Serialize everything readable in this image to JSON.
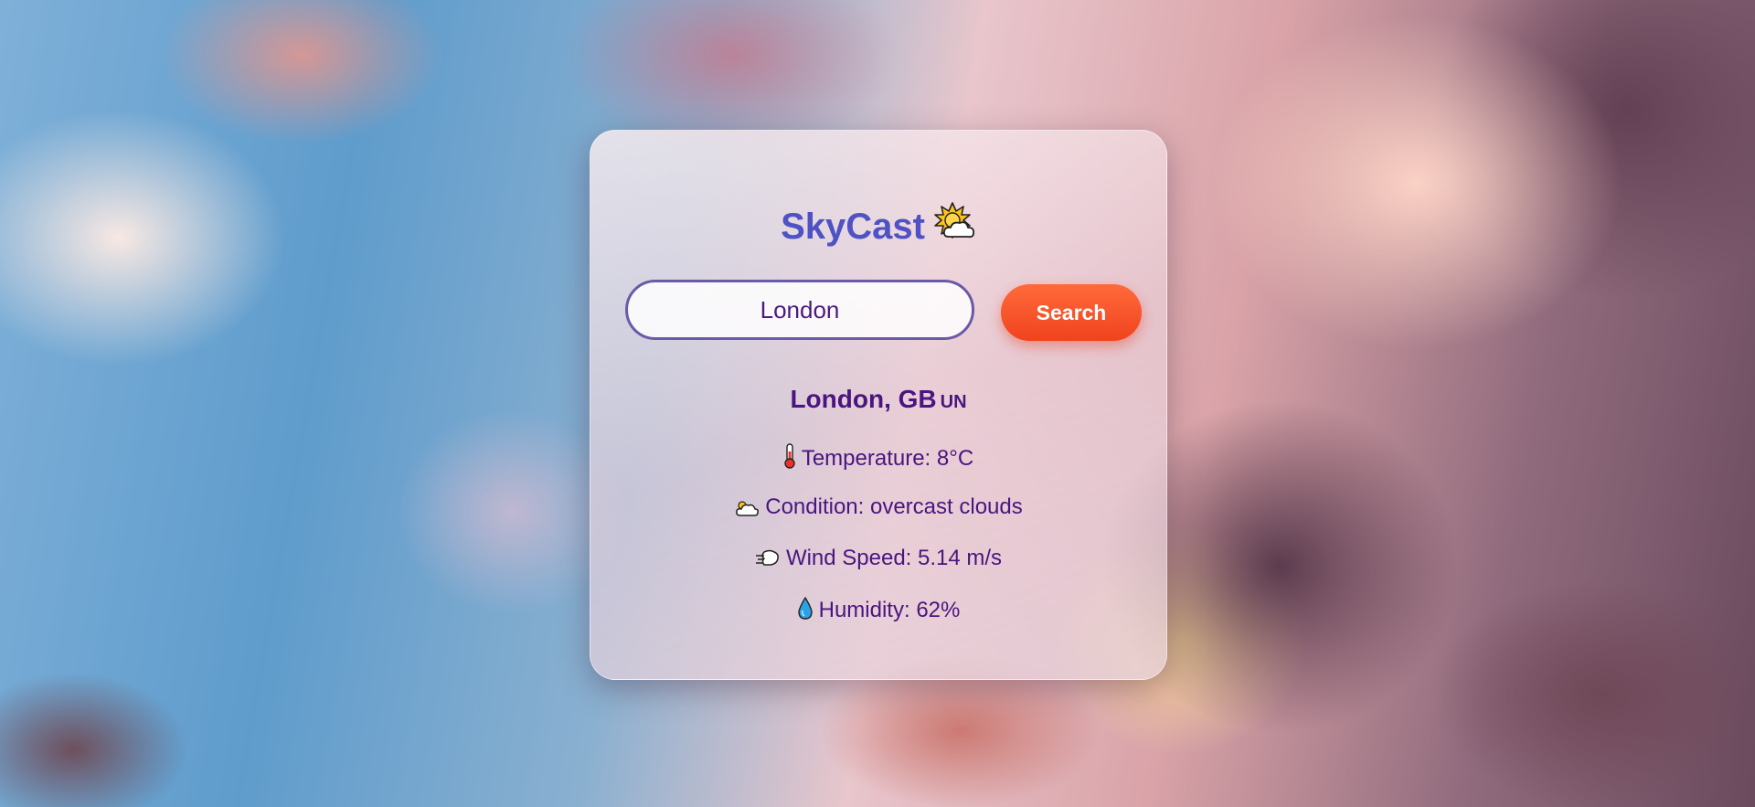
{
  "app": {
    "title": "SkyCast",
    "title_icon": "sun-behind-cloud-icon",
    "accent_color": "#4f52c4"
  },
  "search": {
    "value": "London",
    "placeholder": "",
    "button_label": "Search",
    "button_color": "#f0431e"
  },
  "weather": {
    "location": "London, GB",
    "country_badge": "UN",
    "temperature": {
      "icon": "thermometer-icon",
      "text": "Temperature: 8°C"
    },
    "condition": {
      "icon": "cloud-icon",
      "text": "Condition: overcast clouds"
    },
    "wind": {
      "icon": "wind-icon",
      "text": "Wind Speed: 5.14 m/s"
    },
    "humidity": {
      "icon": "droplet-icon",
      "text": "Humidity: 62%"
    },
    "text_color": "#4a1580"
  }
}
